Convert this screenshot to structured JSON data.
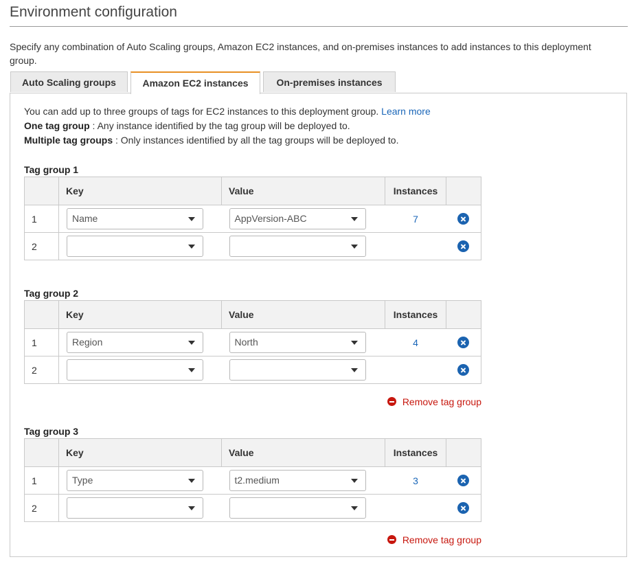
{
  "page": {
    "title": "Environment configuration",
    "description": "Specify any combination of Auto Scaling groups, Amazon EC2 instances, and on-premises instances to add instances to this deployment group."
  },
  "tabs": [
    {
      "label": "Auto Scaling groups",
      "active": false
    },
    {
      "label": "Amazon EC2 instances",
      "active": true
    },
    {
      "label": "On-premises instances",
      "active": false
    }
  ],
  "intro": {
    "line1": "You can add up to three groups of tags for EC2 instances to this deployment group.",
    "learn_more": "Learn more",
    "one_label": "One tag group",
    "one_text": " : Any instance identified by the tag group will be deployed to.",
    "multi_label": "Multiple tag groups",
    "multi_text": " : Only instances identified by all the tag groups will be deployed to."
  },
  "table_headers": {
    "key": "Key",
    "value": "Value",
    "instances": "Instances"
  },
  "remove_group_label": "Remove tag group",
  "tag_groups": [
    {
      "label": "Tag group 1",
      "rows": [
        {
          "num": "1",
          "key": "Name",
          "value": "AppVersion-ABC",
          "instances": "7"
        },
        {
          "num": "2",
          "key": "",
          "value": "",
          "instances": ""
        }
      ]
    },
    {
      "label": "Tag group 2",
      "rows": [
        {
          "num": "1",
          "key": "Region",
          "value": "North",
          "instances": "4"
        },
        {
          "num": "2",
          "key": "",
          "value": "",
          "instances": ""
        }
      ]
    },
    {
      "label": "Tag group 3",
      "rows": [
        {
          "num": "1",
          "key": "Type",
          "value": "t2.medium",
          "instances": "3"
        },
        {
          "num": "2",
          "key": "",
          "value": "",
          "instances": ""
        }
      ]
    }
  ],
  "colors": {
    "accent_tab": "#e88f23",
    "link": "#1a66b8",
    "remove": "#c7170e",
    "remove_icon": "#1b63b0"
  },
  "icons": {
    "row_remove": "close-circle-icon",
    "group_remove": "minus-circle-icon",
    "dropdown": "caret-down-icon"
  }
}
